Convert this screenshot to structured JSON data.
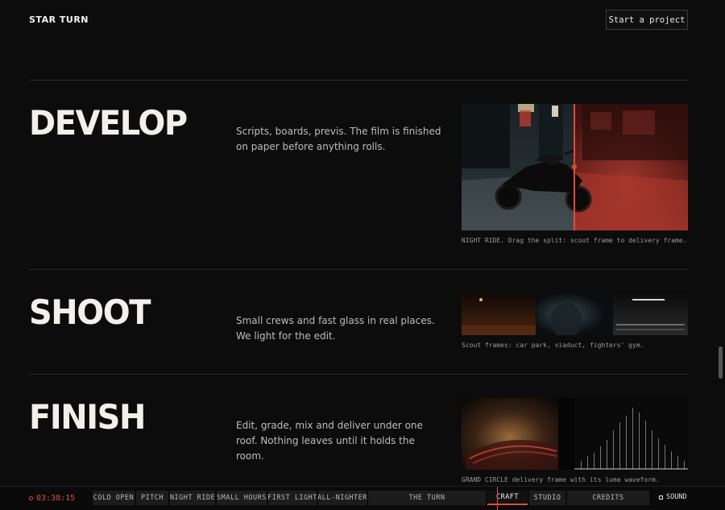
{
  "header": {
    "brand": "STAR TURN",
    "cta_label": "Start a project"
  },
  "sections": [
    {
      "title": "DEVELOP",
      "description": "Scripts, boards, previs. The film is finished on paper before anything rolls.",
      "caption": "NIGHT RIDE. Drag the split: scout frame to delivery frame."
    },
    {
      "title": "SHOOT",
      "description": "Small crews and fast glass in real places. We light for the edit.",
      "caption": "Scout frames: car park, viaduct, fighters' gym."
    },
    {
      "title": "FINISH",
      "description": "Edit, grade, mix and deliver under one roof. Nothing leaves until it holds the room.",
      "caption": "GRAND CIRCLE delivery frame with its luma waveform."
    }
  ],
  "timeline": {
    "timecode": "03:38:15",
    "chapters": [
      "COLD OPEN",
      "PITCH",
      "NIGHT RIDE",
      "SMALL HOURS",
      "FIRST LIGHT",
      "ALL-NIGHTER",
      "THE TURN",
      "CRAFT",
      "STUDIO",
      "CREDITS"
    ],
    "active_chapter": "CRAFT",
    "sound_label": "SOUND"
  },
  "colors": {
    "accent": "#e34a3b",
    "background": "#0c0c0c"
  }
}
